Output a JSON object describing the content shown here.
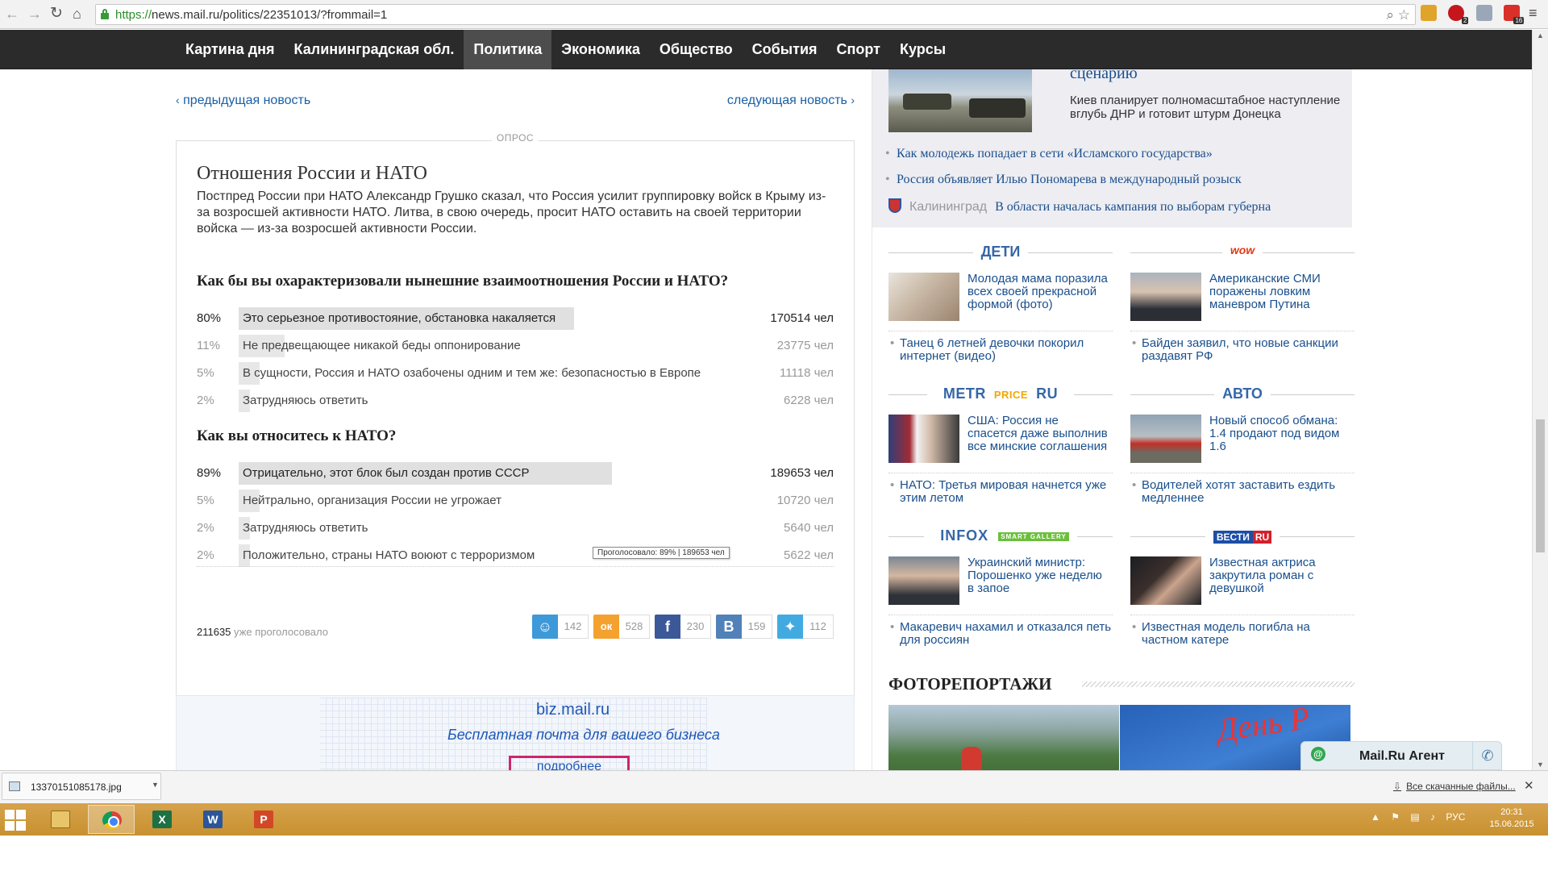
{
  "browser": {
    "url_scheme": "https://",
    "url_rest": "news.mail.ru/politics/22351013/?frommail=1"
  },
  "sitenav": {
    "items": [
      "Картина дня",
      "Калининградская обл.",
      "Политика",
      "Экономика",
      "Общество",
      "События",
      "Спорт",
      "Курсы"
    ],
    "active": "Политика"
  },
  "pager": {
    "prev": "предыдущая новость",
    "next": "следующая новость"
  },
  "poll": {
    "tag": "ОПРОС",
    "title": "Отношения России и НАТО",
    "description": "Постпред России при НАТО Александр Грушко сказал, что Россия усилит группировку войск в Крыму из-за возросшей активности НАТО. Литва, в свою очередь, просит НАТО оставить на своей территории войска — из-за возросшей активности России.",
    "questions": [
      {
        "text": "Как бы вы охарактеризовали нынешние взаимоотношения России и НАТО?",
        "answers": [
          {
            "pct": "80%",
            "share": 0.8,
            "text": "Это серьезное противостояние, обстановка накаляется",
            "count": "170514 чел"
          },
          {
            "pct": "11%",
            "share": 0.11,
            "text": "Не предвещающее никакой беды оппонирование",
            "count": "23775 чел"
          },
          {
            "pct": "5%",
            "share": 0.05,
            "text": "В сущности, Россия и НАТО озабочены одним и тем же: безопасностью в Европе",
            "count": "11118 чел"
          },
          {
            "pct": "2%",
            "share": 0.02,
            "text": "Затрудняюсь ответить",
            "count": "6228 чел"
          }
        ]
      },
      {
        "text": "Как вы относитесь к НАТО?",
        "answers": [
          {
            "pct": "89%",
            "share": 0.89,
            "text": "Отрицательно, этот блок был создан против СССР",
            "count": "189653 чел"
          },
          {
            "pct": "5%",
            "share": 0.05,
            "text": "Нейтрально, организация России не угрожает",
            "count": "10720 чел"
          },
          {
            "pct": "2%",
            "share": 0.02,
            "text": "Затрудняюсь ответить",
            "count": "5640 чел"
          },
          {
            "pct": "2%",
            "share": 0.02,
            "text": "Положительно, страны НАТО воюют с терроризмом",
            "count": "5622 чел"
          }
        ]
      }
    ],
    "tooltip": "Проголосовало: 89% | 189653 чел",
    "total_number": "211635",
    "total_label": "уже проголосовало",
    "share": [
      {
        "icon": "moimir",
        "color": "#3e99d8",
        "count": "142"
      },
      {
        "icon": "odnoklassniki",
        "color": "#f4a12f",
        "count": "528"
      },
      {
        "icon": "facebook",
        "color": "#3b5998",
        "count": "230"
      },
      {
        "icon": "vkontakte",
        "color": "#5181b8",
        "count": "159"
      },
      {
        "icon": "twitter",
        "color": "#41abe1",
        "count": "112"
      }
    ]
  },
  "banner": {
    "brand": "biz.mail.ru",
    "tagline": "Бесплатная почта для вашего бизнеса",
    "button": "подробнее"
  },
  "topnews": {
    "title": "сценарию",
    "desc": "Киев планирует полномасштабное наступление вглубь ДНР и готовит штурм Донецка",
    "links": [
      "Как молодежь попадает в сети «Исламского государства»",
      "Россия объявляет Илью Пономарева в международный розыск"
    ],
    "region": "Калининград",
    "region_link": "В области началась кампания по выборам губерна"
  },
  "rubrics": {
    "deti": {
      "head": "ДЕТИ",
      "main": "Молодая мама поразила всех своей прекрасной формой (фото)",
      "sub": "Танец 6 летней девочки покорил интернет (видео)"
    },
    "wow": {
      "head": "wow",
      "main": "Американские СМИ поражены ловким маневром Путина",
      "sub": "Байден заявил, что новые санкции раздавят РФ"
    },
    "metr": {
      "head_a": "METR",
      "head_b": "PRICE",
      "head_c": "RU",
      "main": "США: Россия не спасется даже выполнив все минские соглашения",
      "sub": "НАТО: Третья мировая начнется уже этим летом"
    },
    "avto": {
      "head": "АВТО",
      "main": "Новый способ обмана: 1.4 продают под видом 1.6",
      "sub": "Водителей хотят заставить ездить медленнее"
    },
    "infox": {
      "head": "INFOX",
      "badge": "SMART GALLERY",
      "main": "Украинский министр: Порошенко уже неделю в запое",
      "sub": "Макаревич нахамил и отказался петь для россиян"
    },
    "vesti": {
      "head_a": "ВЕСТИ",
      "head_b": "RU",
      "main": "Известная актриса закрутила роман с девушкой",
      "sub": "Известная модель погибла на частном катере"
    }
  },
  "photoreports": {
    "head": "ФОТОРЕПОРТАЖИ",
    "photo2_text": "День Р"
  },
  "agent": {
    "label": "Mail.Ru Агент"
  },
  "download": {
    "filename": "13370151085178.jpg",
    "all_link": "Все скачанные файлы..."
  },
  "taskbar": {
    "tray_lang": "РУС",
    "time": "20:31",
    "date": "15.06.2015"
  }
}
